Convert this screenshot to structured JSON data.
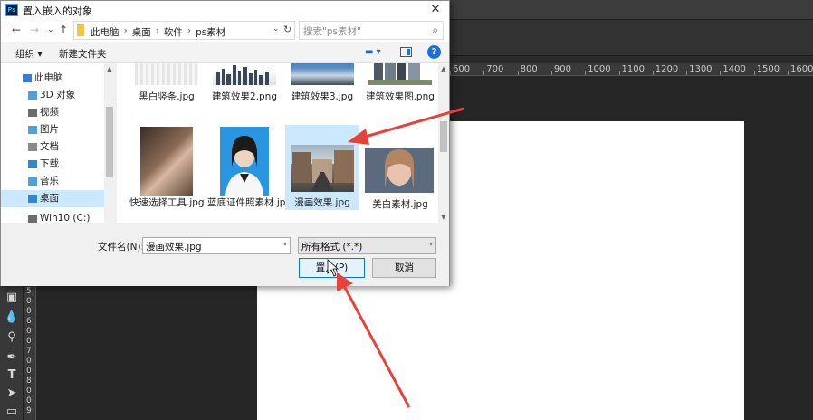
{
  "dialog": {
    "title": "置入嵌入的对象",
    "app_icon": "Ps",
    "close": "✕"
  },
  "address": {
    "crumbs": [
      "此电脑",
      "桌面",
      "软件",
      "ps素材"
    ],
    "search_placeholder": "搜索\"ps素材\""
  },
  "toolbar": {
    "organize": "组织 ▾",
    "new_folder": "新建文件夹"
  },
  "nav": {
    "items": [
      {
        "label": "此电脑",
        "icon": "computer-icon",
        "color": "#3a7bd5"
      },
      {
        "label": "3D 对象",
        "icon": "3d-objects-icon",
        "color": "#4aa3df"
      },
      {
        "label": "视频",
        "icon": "video-folder-icon",
        "color": "#6b6b6b"
      },
      {
        "label": "图片",
        "icon": "pictures-folder-icon",
        "color": "#4aa3df"
      },
      {
        "label": "文档",
        "icon": "documents-folder-icon",
        "color": "#8a8a8a"
      },
      {
        "label": "下载",
        "icon": "downloads-folder-icon",
        "color": "#2a8ad4"
      },
      {
        "label": "音乐",
        "icon": "music-folder-icon",
        "color": "#4aa3df"
      },
      {
        "label": "桌面",
        "icon": "desktop-folder-icon",
        "color": "#2a8ad4"
      },
      {
        "label": "Win10 (C:)",
        "icon": "drive-icon",
        "color": "#6b6b6b"
      }
    ]
  },
  "files": [
    {
      "name": "黑白竖条.jpg"
    },
    {
      "name": "建筑效果2.png"
    },
    {
      "name": "建筑效果3.jpg"
    },
    {
      "name": "建筑效果图.png"
    },
    {
      "name": "快速选择工具.jpg"
    },
    {
      "name": "蓝底证件照素材.jpg"
    },
    {
      "name": "漫画效果.jpg"
    },
    {
      "name": "美白素材.jpg"
    }
  ],
  "bottom": {
    "filename_label": "文件名(N):",
    "filename_value": "漫画效果.jpg",
    "filter_value": "所有格式 (*.*)",
    "place_label": "置入(P)",
    "cancel_label": "取消"
  },
  "ruler": {
    "ticks": [
      "600",
      "700",
      "800",
      "900",
      "1000",
      "1100",
      "1200",
      "1300",
      "1400",
      "1500",
      "1600"
    ]
  },
  "vruler": {
    "ticks": [
      "5",
      "0",
      "0",
      "6",
      "0",
      "0",
      "7",
      "0",
      "0",
      "8",
      "0",
      "0",
      "9"
    ]
  },
  "colors": {
    "accent": "#1f6fd1",
    "selection": "#cce8ff",
    "arrow": "#e8413c"
  }
}
